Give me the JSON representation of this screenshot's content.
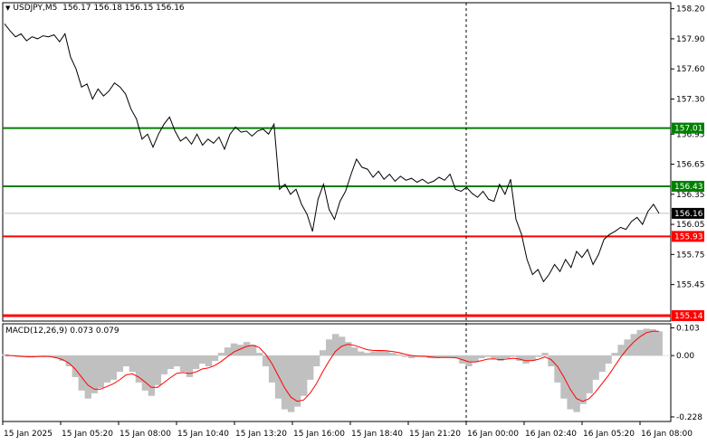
{
  "header": {
    "symbol": "USDJPY,M5",
    "ohlc": "156.17 156.18 156.15 156.16"
  },
  "macd_header": {
    "label": "MACD(12,26,9)",
    "values": "0.073 0.079"
  },
  "colors": {
    "price_line": "#000000",
    "support_green": "#008000",
    "resistance_red": "#ff0000",
    "macd_hist": "#c0c0c0",
    "macd_signal": "#ff0000",
    "current_price_badge": "#000000",
    "axis": "#000000"
  },
  "price_axis": {
    "ticks": [
      "158.20",
      "157.90",
      "157.60",
      "157.30",
      "156.95",
      "156.65",
      "156.35",
      "156.05",
      "155.75",
      "155.45"
    ],
    "current_price": "156.16"
  },
  "levels": [
    {
      "price": 157.01,
      "label": "157.01",
      "color": "#008000"
    },
    {
      "price": 156.43,
      "label": "156.43",
      "color": "#008000"
    },
    {
      "price": 155.93,
      "label": "155.93",
      "color": "#ff0000"
    },
    {
      "price": 155.14,
      "label": "155.14",
      "color": "#ff0000"
    }
  ],
  "macd_axis": {
    "ticks": [
      "0.103",
      "0.00",
      "-0.228"
    ]
  },
  "time_axis": {
    "labels": [
      "15 Jan 2025",
      "15 Jan 05:20",
      "15 Jan 08:00",
      "15 Jan 10:40",
      "15 Jan 13:20",
      "15 Jan 16:00",
      "15 Jan 18:40",
      "15 Jan 21:20",
      "16 Jan 00:00",
      "16 Jan 02:40",
      "16 Jan 05:20",
      "16 Jan 08:00"
    ]
  },
  "chart_data": [
    {
      "type": "line",
      "name": "USDJPY,M5",
      "x_labels": [
        "15 Jan 2025",
        "15 Jan 05:20",
        "15 Jan 08:00",
        "15 Jan 10:40",
        "15 Jan 13:20",
        "15 Jan 16:00",
        "15 Jan 18:40",
        "15 Jan 21:20",
        "16 Jan 00:00",
        "16 Jan 02:40",
        "16 Jan 05:20",
        "16 Jan 08:00"
      ],
      "ylim": [
        155.14,
        158.26
      ],
      "values": [
        158.05,
        157.98,
        157.92,
        157.95,
        157.88,
        157.92,
        157.9,
        157.93,
        157.92,
        157.94,
        157.87,
        157.95,
        157.72,
        157.6,
        157.42,
        157.45,
        157.3,
        157.4,
        157.33,
        157.38,
        157.46,
        157.42,
        157.35,
        157.2,
        157.1,
        156.9,
        156.95,
        156.82,
        156.95,
        157.05,
        157.12,
        156.98,
        156.88,
        156.92,
        156.85,
        156.95,
        156.84,
        156.9,
        156.86,
        156.92,
        156.8,
        156.95,
        157.02,
        156.97,
        156.98,
        156.93,
        156.98,
        157.0,
        156.95,
        157.05,
        156.4,
        156.45,
        156.35,
        156.4,
        156.25,
        156.15,
        155.98,
        156.3,
        156.45,
        156.2,
        156.1,
        156.28,
        156.38,
        156.55,
        156.7,
        156.62,
        156.6,
        156.52,
        156.58,
        156.5,
        156.55,
        156.48,
        156.53,
        156.49,
        156.51,
        156.47,
        156.5,
        156.46,
        156.48,
        156.52,
        156.49,
        156.55,
        156.4,
        156.38,
        156.42,
        156.36,
        156.32,
        156.38,
        156.3,
        156.28,
        156.45,
        156.35,
        156.5,
        156.1,
        155.95,
        155.7,
        155.55,
        155.6,
        155.48,
        155.55,
        155.65,
        155.58,
        155.7,
        155.62,
        155.78,
        155.72,
        155.8,
        155.65,
        155.75,
        155.9,
        155.95,
        155.98,
        156.02,
        156.0,
        156.08,
        156.12,
        156.05,
        156.18,
        156.25,
        156.16
      ]
    },
    {
      "type": "bar",
      "name": "MACD(12,26,9)",
      "x_labels": [
        "15 Jan 2025",
        "15 Jan 05:20",
        "15 Jan 08:00",
        "15 Jan 10:40",
        "15 Jan 13:20",
        "15 Jan 16:00",
        "15 Jan 18:40",
        "15 Jan 21:20",
        "16 Jan 00:00",
        "16 Jan 02:40",
        "16 Jan 05:20",
        "16 Jan 08:00"
      ],
      "ylim": [
        -0.245,
        0.118
      ],
      "histogram": [
        0.005,
        0.0,
        -0.005,
        -0.005,
        -0.003,
        0.0,
        0.0,
        -0.004,
        -0.01,
        -0.02,
        -0.04,
        -0.08,
        -0.13,
        -0.16,
        -0.14,
        -0.12,
        -0.1,
        -0.09,
        -0.06,
        -0.04,
        -0.06,
        -0.1,
        -0.13,
        -0.15,
        -0.11,
        -0.07,
        -0.05,
        -0.04,
        -0.06,
        -0.08,
        -0.05,
        -0.03,
        -0.04,
        -0.02,
        0.01,
        0.03,
        0.045,
        0.04,
        0.05,
        0.04,
        0.01,
        -0.04,
        -0.1,
        -0.16,
        -0.2,
        -0.21,
        -0.19,
        -0.15,
        -0.09,
        -0.04,
        0.02,
        0.06,
        0.08,
        0.07,
        0.05,
        0.03,
        0.015,
        0.01,
        0.015,
        0.02,
        0.018,
        0.01,
        0.005,
        -0.005,
        -0.01,
        -0.005,
        -0.005,
        -0.01,
        -0.01,
        -0.008,
        -0.006,
        -0.01,
        -0.03,
        -0.04,
        -0.025,
        -0.01,
        -0.005,
        -0.01,
        -0.02,
        -0.01,
        -0.005,
        -0.02,
        -0.03,
        -0.02,
        -0.005,
        0.01,
        -0.04,
        -0.1,
        -0.16,
        -0.2,
        -0.21,
        -0.18,
        -0.14,
        -0.09,
        -0.06,
        -0.03,
        0.01,
        0.04,
        0.06,
        0.08,
        0.095,
        0.1,
        0.098,
        0.09
      ],
      "signal": [
        0.0,
        0.0,
        -0.002,
        -0.004,
        -0.005,
        -0.004,
        -0.003,
        -0.004,
        -0.008,
        -0.015,
        -0.028,
        -0.05,
        -0.08,
        -0.11,
        -0.125,
        -0.125,
        -0.115,
        -0.105,
        -0.09,
        -0.072,
        -0.068,
        -0.08,
        -0.098,
        -0.118,
        -0.118,
        -0.1,
        -0.082,
        -0.066,
        -0.063,
        -0.067,
        -0.061,
        -0.05,
        -0.046,
        -0.037,
        -0.022,
        -0.004,
        0.013,
        0.024,
        0.034,
        0.038,
        0.03,
        0.005,
        -0.03,
        -0.075,
        -0.12,
        -0.155,
        -0.17,
        -0.165,
        -0.14,
        -0.105,
        -0.06,
        -0.02,
        0.015,
        0.035,
        0.042,
        0.038,
        0.03,
        0.022,
        0.019,
        0.019,
        0.018,
        0.015,
        0.011,
        0.005,
        0.0,
        -0.002,
        -0.003,
        -0.005,
        -0.007,
        -0.007,
        -0.007,
        -0.008,
        -0.015,
        -0.023,
        -0.024,
        -0.019,
        -0.013,
        -0.012,
        -0.015,
        -0.013,
        -0.01,
        -0.013,
        -0.019,
        -0.019,
        -0.014,
        -0.005,
        -0.015,
        -0.04,
        -0.08,
        -0.125,
        -0.16,
        -0.17,
        -0.16,
        -0.135,
        -0.105,
        -0.075,
        -0.04,
        -0.005,
        0.025,
        0.05,
        0.07,
        0.085,
        0.09,
        0.09
      ]
    }
  ]
}
